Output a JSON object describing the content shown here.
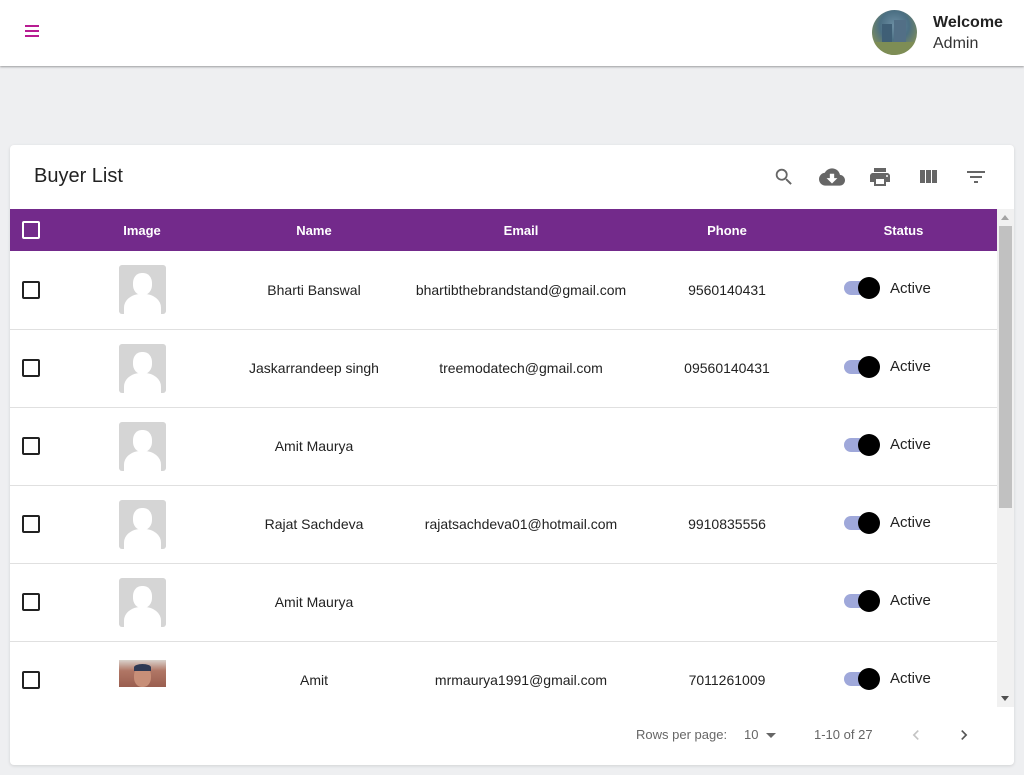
{
  "header": {
    "menu_icon": "hamburger-menu-icon",
    "welcome_label": "Welcome",
    "user_name": "Admin",
    "accent_color": "#b81c92"
  },
  "card": {
    "title": "Buyer List",
    "toolbar": [
      {
        "name": "search",
        "icon": "search-icon"
      },
      {
        "name": "download",
        "icon": "cloud-download-icon"
      },
      {
        "name": "print",
        "icon": "print-icon"
      },
      {
        "name": "view-columns",
        "icon": "view-columns-icon"
      },
      {
        "name": "filter",
        "icon": "filter-list-icon"
      }
    ]
  },
  "table": {
    "header_color": "#732a8b",
    "columns": [
      "Image",
      "Name",
      "Email",
      "Phone",
      "Status"
    ],
    "rows": [
      {
        "image": "placeholder",
        "name": "Bharti Banswal",
        "email": "bhartibthebrandstand@gmail.com",
        "phone": "9560140431",
        "status": "Active",
        "active": true
      },
      {
        "image": "placeholder",
        "name": "Jaskarrandeep singh",
        "email": "treemodatech@gmail.com",
        "phone": "09560140431",
        "status": "Active",
        "active": true
      },
      {
        "image": "placeholder",
        "name": "Amit Maurya",
        "email": "",
        "phone": "",
        "status": "Active",
        "active": true
      },
      {
        "image": "placeholder",
        "name": "Rajat Sachdeva",
        "email": "rajatsachdeva01@hotmail.com",
        "phone": "9910835556",
        "status": "Active",
        "active": true
      },
      {
        "image": "placeholder",
        "name": "Amit Maurya",
        "email": "",
        "phone": "",
        "status": "Active",
        "active": true
      },
      {
        "image": "photo",
        "name": "Amit",
        "email": "mrmaurya1991@gmail.com",
        "phone": "7011261009",
        "status": "Active",
        "active": true
      }
    ]
  },
  "pagination": {
    "rows_per_page_label": "Rows per page:",
    "rows_per_page_value": "10",
    "range_text": "1-10 of 27"
  }
}
